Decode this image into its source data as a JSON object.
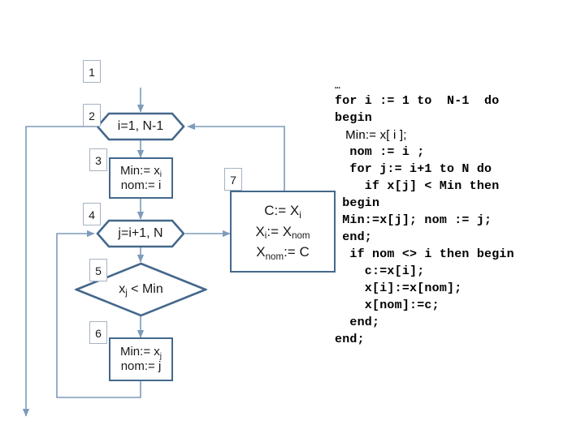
{
  "diagram": {
    "title": "selection-sort-flowchart",
    "colors": {
      "shape_border": "#44688c",
      "connector": "#7d9bbb",
      "tag_border": "#a6b3c2",
      "text": "#1a1a1a",
      "background": "#ffffff"
    },
    "tags": [
      {
        "id": "tag-1",
        "label": "1"
      },
      {
        "id": "tag-2",
        "label": "2"
      },
      {
        "id": "tag-3",
        "label": "3"
      },
      {
        "id": "tag-4",
        "label": "4"
      },
      {
        "id": "tag-5",
        "label": "5"
      },
      {
        "id": "tag-6",
        "label": "6"
      },
      {
        "id": "tag-7",
        "label": "7"
      }
    ],
    "nodes": {
      "loop_i": {
        "shape": "hexagon",
        "text": "i=1, N-1"
      },
      "init_min": {
        "shape": "rectangle",
        "line1_pre": "Min:= x",
        "line1_sub": "i",
        "line2": "nom:= i"
      },
      "loop_j": {
        "shape": "hexagon",
        "text": "j=i+1, N"
      },
      "compare": {
        "shape": "diamond",
        "text_pre": "x",
        "text_sub": "j",
        "text_post": " < Min"
      },
      "update_min": {
        "shape": "rectangle",
        "line1_pre": "Min:= x",
        "line1_sub": "j",
        "line2": "nom:= j"
      },
      "swap": {
        "shape": "rectangle",
        "line1_pre": "C:= X",
        "line1_sub": "i",
        "line2_a": "X",
        "line2_a_sub": "i",
        "line2_b": ":= X",
        "line2_b_sub": "nom",
        "line3_a": "X",
        "line3_a_sub": "nom",
        "line3_b": ":= C"
      }
    }
  },
  "code": {
    "lines": [
      {
        "text": "…",
        "style": "dots"
      },
      {
        "text": "for i := 1 to  N-1  do",
        "style": "mono"
      },
      {
        "text": "begin",
        "style": "mono"
      },
      {
        "text": "   Min:= x[ i ];",
        "style": "sans"
      },
      {
        "text": "  nom := i ;",
        "style": "mono"
      },
      {
        "text": "  for j:= i+1 to N do",
        "style": "mono"
      },
      {
        "text": "    if x[j] < Min then",
        "style": "mono"
      },
      {
        "text": " begin",
        "style": "mono"
      },
      {
        "text": " Min:=x[j]; nom := j;",
        "style": "mono"
      },
      {
        "text": " end;",
        "style": "mono"
      },
      {
        "text": "  if nom <> i then begin",
        "style": "mono"
      },
      {
        "text": "    c:=x[i];",
        "style": "mono"
      },
      {
        "text": "    x[i]:=x[nom];",
        "style": "mono"
      },
      {
        "text": "    x[nom]:=c;",
        "style": "mono"
      },
      {
        "text": "  end;",
        "style": "mono"
      },
      {
        "text": "end;",
        "style": "mono"
      }
    ]
  }
}
